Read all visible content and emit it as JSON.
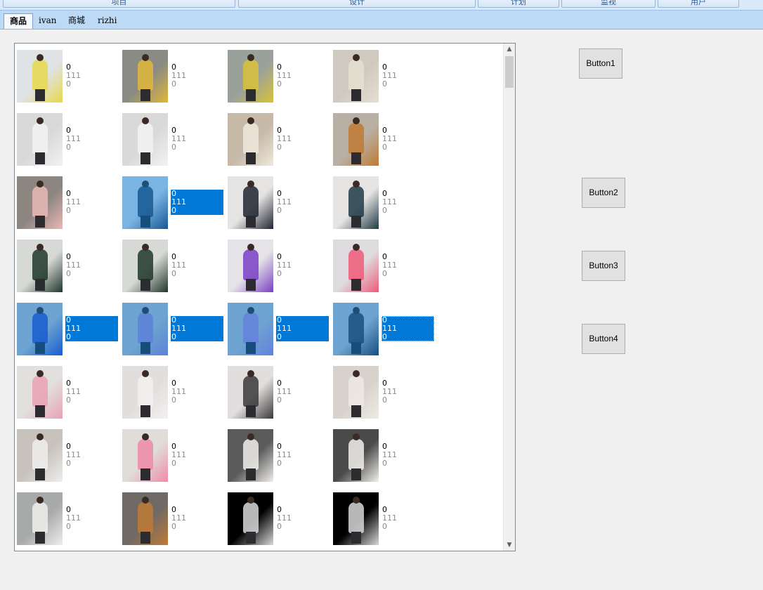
{
  "menu": {
    "items": [
      {
        "label": "项目"
      },
      {
        "label": "设计"
      },
      {
        "label": "计划"
      },
      {
        "label": "监视"
      },
      {
        "label": "用户"
      }
    ]
  },
  "tabs": [
    {
      "label": "商品",
      "active": true
    },
    {
      "label": "ivan",
      "active": false
    },
    {
      "label": "商城",
      "active": false
    },
    {
      "label": "rizhi",
      "active": false
    }
  ],
  "product_list": {
    "selection_color": "#0078d7",
    "items": [
      {
        "line1": "0",
        "line2": "111",
        "line3": "0",
        "colors": [
          "#dfe3e6",
          "#e8d84a"
        ],
        "selected": false
      },
      {
        "line1": "0",
        "line2": "111",
        "line3": "0",
        "colors": [
          "#8a8b82",
          "#e0b73a"
        ],
        "selected": false
      },
      {
        "line1": "0",
        "line2": "111",
        "line3": "0",
        "colors": [
          "#9aa19a",
          "#d8c23a"
        ],
        "selected": false
      },
      {
        "line1": "0",
        "line2": "111",
        "line3": "0",
        "colors": [
          "#cfc9c0",
          "#e6e0d2"
        ],
        "selected": false
      },
      {
        "line1": "0",
        "line2": "111",
        "line3": "0",
        "colors": [
          "#d9d9d9",
          "#f2f2f2"
        ],
        "selected": false
      },
      {
        "line1": "0",
        "line2": "111",
        "line3": "0",
        "colors": [
          "#d9d9d9",
          "#f2f2f2"
        ],
        "selected": false
      },
      {
        "line1": "0",
        "line2": "111",
        "line3": "0",
        "colors": [
          "#c6b9a8",
          "#efe8dc"
        ],
        "selected": false
      },
      {
        "line1": "0",
        "line2": "111",
        "line3": "0",
        "colors": [
          "#b9b0a5",
          "#c07a34"
        ],
        "selected": false
      },
      {
        "line1": "0",
        "line2": "111",
        "line3": "0",
        "colors": [
          "#8c8580",
          "#e9b8b6"
        ],
        "selected": false
      },
      {
        "line1": "0",
        "line2": "111",
        "line3": "0",
        "colors": [
          "#dfe6ee",
          "#2a3e5a"
        ],
        "selected": true
      },
      {
        "line1": "0",
        "line2": "111",
        "line3": "0",
        "colors": [
          "#e6e4e2",
          "#1f2430"
        ],
        "selected": false
      },
      {
        "line1": "0",
        "line2": "111",
        "line3": "0",
        "colors": [
          "#e6e4e2",
          "#1f3a45"
        ],
        "selected": false
      },
      {
        "line1": "0",
        "line2": "111",
        "line3": "0",
        "colors": [
          "#d7d9d6",
          "#20362c"
        ],
        "selected": false
      },
      {
        "line1": "0",
        "line2": "111",
        "line3": "0",
        "colors": [
          "#d7d9d6",
          "#20362c"
        ],
        "selected": false
      },
      {
        "line1": "0",
        "line2": "111",
        "line3": "0",
        "colors": [
          "#e5e3e7",
          "#7a3fc4"
        ],
        "selected": false
      },
      {
        "line1": "0",
        "line2": "111",
        "line3": "0",
        "colors": [
          "#dedcde",
          "#f05a7a"
        ],
        "selected": false
      },
      {
        "line1": "0",
        "line2": "111",
        "line3": "0",
        "colors": [
          "#c9c9cc",
          "#2a47c8"
        ],
        "selected": true
      },
      {
        "line1": "0",
        "line2": "111",
        "line3": "0",
        "colors": [
          "#c9c9cc",
          "#a989d8"
        ],
        "selected": true
      },
      {
        "line1": "0",
        "line2": "111",
        "line3": "0",
        "colors": [
          "#c9c9cc",
          "#b48ae0"
        ],
        "selected": true
      },
      {
        "line1": "0",
        "line2": "111",
        "line3": "0",
        "colors": [
          "#c9c9cc",
          "#2a2f3a"
        ],
        "selected": true,
        "focused": true
      },
      {
        "line1": "0",
        "line2": "111",
        "line3": "0",
        "colors": [
          "#e2e0df",
          "#e9a1b3"
        ],
        "selected": false
      },
      {
        "line1": "0",
        "line2": "111",
        "line3": "0",
        "colors": [
          "#e2dedd",
          "#f2f0f0"
        ],
        "selected": false
      },
      {
        "line1": "0",
        "line2": "111",
        "line3": "0",
        "colors": [
          "#e2dedd",
          "#3a3a3a"
        ],
        "selected": false
      },
      {
        "line1": "0",
        "line2": "111",
        "line3": "0",
        "colors": [
          "#d8d2cc",
          "#eeeae4"
        ],
        "selected": false
      },
      {
        "line1": "0",
        "line2": "111",
        "line3": "0",
        "colors": [
          "#c8c2bc",
          "#eeeeee"
        ],
        "selected": false
      },
      {
        "line1": "0",
        "line2": "111",
        "line3": "0",
        "colors": [
          "#e0dcd8",
          "#ef8aa8"
        ],
        "selected": false
      },
      {
        "line1": "0",
        "line2": "111",
        "line3": "0",
        "colors": [
          "#5a5a5a",
          "#f0eeea"
        ],
        "selected": false
      },
      {
        "line1": "0",
        "line2": "111",
        "line3": "0",
        "colors": [
          "#4a4a4a",
          "#f2f0ec"
        ],
        "selected": false
      },
      {
        "line1": "0",
        "line2": "111",
        "line3": "0",
        "colors": [
          "#a8aaa9",
          "#efeeec"
        ],
        "selected": false
      },
      {
        "line1": "0",
        "line2": "111",
        "line3": "0",
        "colors": [
          "#6f6a65",
          "#c07a34"
        ],
        "selected": false
      },
      {
        "line1": "0",
        "line2": "111",
        "line3": "0",
        "colors": [
          "#000000",
          "#d8d8d8"
        ],
        "selected": false
      },
      {
        "line1": "0",
        "line2": "111",
        "line3": "0",
        "colors": [
          "#000000",
          "#d8d8d8"
        ],
        "selected": false
      }
    ]
  },
  "buttons": {
    "button1": "Button1",
    "button2": "Button2",
    "button3": "Button3",
    "button4": "Button4"
  },
  "scrollbar": {
    "up_glyph": "▲",
    "down_glyph": "▼"
  }
}
